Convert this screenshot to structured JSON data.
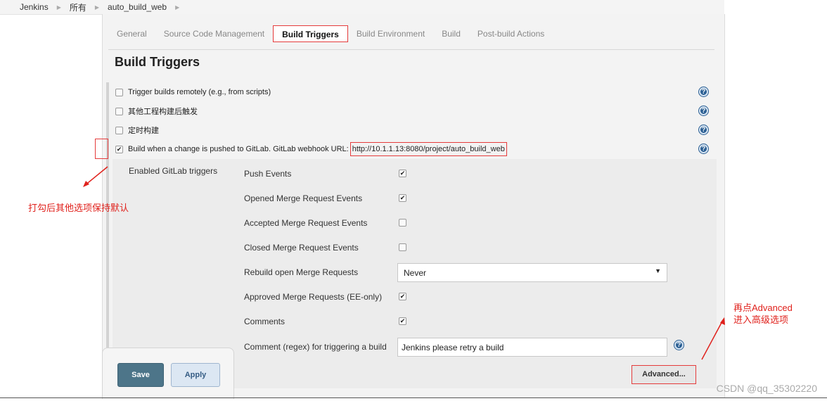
{
  "breadcrumb": [
    "Jenkins",
    "所有",
    "auto_build_web"
  ],
  "tabs": [
    {
      "label": "General"
    },
    {
      "label": "Source Code Management"
    },
    {
      "label": "Build Triggers"
    },
    {
      "label": "Build Environment"
    },
    {
      "label": "Build"
    },
    {
      "label": "Post-build Actions"
    }
  ],
  "active_tab": "Build Triggers",
  "section_title": "Build Triggers",
  "triggers": [
    {
      "label": "Trigger builds remotely (e.g., from scripts)",
      "checked": false
    },
    {
      "label": "其他工程构建后触发",
      "checked": false
    },
    {
      "label": "定时构建",
      "checked": false
    },
    {
      "label": "Build when a change is pushed to GitLab. GitLab webhook URL:",
      "url": "http://10.1.1.13:8080/project/auto_build_web",
      "checked": true
    }
  ],
  "gitlab": {
    "section_label": "Enabled GitLab triggers",
    "options": [
      {
        "label": "Push Events",
        "checked": true
      },
      {
        "label": "Opened Merge Request Events",
        "checked": true
      },
      {
        "label": "Accepted Merge Request Events",
        "checked": false
      },
      {
        "label": "Closed Merge Request Events",
        "checked": false
      }
    ],
    "rebuild_label": "Rebuild open Merge Requests",
    "rebuild_value": "Never",
    "approved_label": "Approved Merge Requests (EE-only)",
    "approved_checked": true,
    "comments_label": "Comments",
    "comments_checked": true,
    "comment_regex_label": "Comment (regex) for triggering a build",
    "comment_regex_value": "Jenkins please retry a build",
    "advanced_label": "Advanced..."
  },
  "buttons": {
    "save": "Save",
    "apply": "Apply"
  },
  "annotations": {
    "left": "打勾后其他选项保持默认",
    "right_line1": "再点Advanced",
    "right_line2": "进入高级选项"
  },
  "watermark": "CSDN @qq_35302220",
  "colors": {
    "annotation": "#e0211c",
    "save_button": "#4d7589",
    "help_icon": "#2b5f93"
  },
  "icons": {
    "help": "question-help-icon",
    "breadcrumb_separator": "triangle-right-icon",
    "select_arrow": "caret-down-icon"
  }
}
